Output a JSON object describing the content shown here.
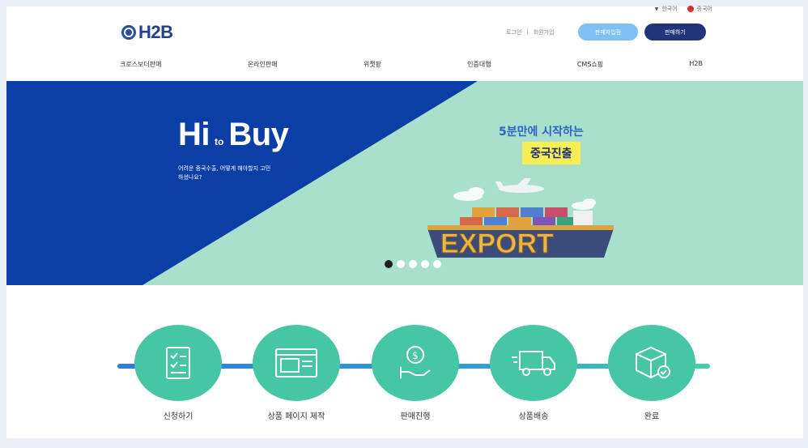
{
  "utility": {
    "lang1": "한국어",
    "lang2": "중국어"
  },
  "header": {
    "logo": "H2B",
    "link_login": "로그인",
    "link_join": "회원가입",
    "btn_seller": "판매자입점",
    "btn_buyer": "판매하기"
  },
  "nav": {
    "items": [
      "크로스보더판매",
      "온라인판매",
      "위챗팡",
      "인증대행",
      "CMS쇼핑",
      "H2B"
    ]
  },
  "hero": {
    "title_main_1": "Hi",
    "title_small": "to",
    "title_main_2": "Buy",
    "subtitle": "어려운 중국수출, 어떻게 해야할지 고민하셨나요?",
    "right_line1": "5분만에 시작하는",
    "right_highlight": "중국진출",
    "export_text": "EXPORT",
    "slides": 5,
    "active_slide": 1
  },
  "process": {
    "steps": [
      {
        "label": "신청하기",
        "icon": "document-checklist-icon"
      },
      {
        "label": "상품 페이지 제작",
        "icon": "web-page-icon"
      },
      {
        "label": "판매진행",
        "icon": "money-hand-icon"
      },
      {
        "label": "상품배송",
        "icon": "delivery-truck-icon"
      },
      {
        "label": "완료",
        "icon": "box-check-icon"
      }
    ]
  },
  "colors": {
    "brand_navy": "#24418d",
    "hero_blue": "#0b3fa6",
    "hero_mint": "#a9e0cc",
    "step_green": "#47c6a5",
    "line_blue": "#2e7be0"
  }
}
